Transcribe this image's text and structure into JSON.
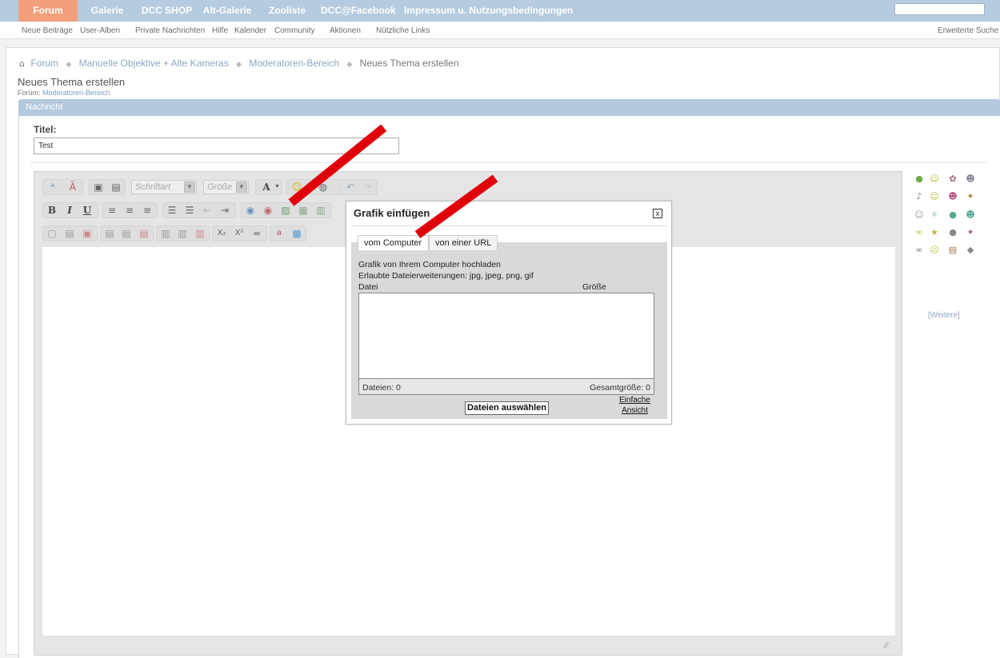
{
  "topnav": {
    "items": [
      "Forum",
      "Galerie",
      "DCC SHOP",
      "Alt-Galerie",
      "Zooliste",
      "DCC@Facebook",
      "Impressum u. Nutzungsbedingungen"
    ]
  },
  "subnav": {
    "items": [
      "Neue Beiträge",
      "User-Alben",
      "Private Nachrichten",
      "Hilfe",
      "Kalender",
      "Community",
      "Aktionen",
      "Nützliche Links"
    ],
    "advanced_search": "Erweiterte Suche"
  },
  "breadcrumb": [
    "Forum",
    "Manuelle Objektive + Alte Kameras",
    "Moderatoren-Bereich",
    "Neues Thema erstellen"
  ],
  "page": {
    "title": "Neues Thema erstellen",
    "forum_label": "Forum:",
    "forum_name": "Moderatoren-Bereich",
    "section_header": "Nachricht"
  },
  "form": {
    "title_label": "Titel:",
    "title_value": "Test"
  },
  "editor": {
    "font_select": "Schriftart",
    "size_select": "Größe"
  },
  "smilies": {
    "more_link": "[Weitere]"
  },
  "dialog": {
    "title": "Grafik einfügen",
    "close": "x",
    "tabs": [
      "vom Computer",
      "von einer URL"
    ],
    "upload_heading": "Grafik von Ihrem Computer hochladen",
    "allowed_ext": "Erlaubte Dateierweiterungen: jpg, jpeg, png, gif",
    "col_file": "Datei",
    "col_size": "Größe",
    "files_count": "Dateien: 0",
    "total_size": "Gesamtgröße: 0",
    "select_button": "Dateien auswählen",
    "simple_view_1": "Einfache",
    "simple_view_2": "Ansicht"
  },
  "colors": {
    "accent_red": "#e0000a",
    "nav_blue": "#b5cbe0",
    "active_tab": "#f2a07b"
  }
}
